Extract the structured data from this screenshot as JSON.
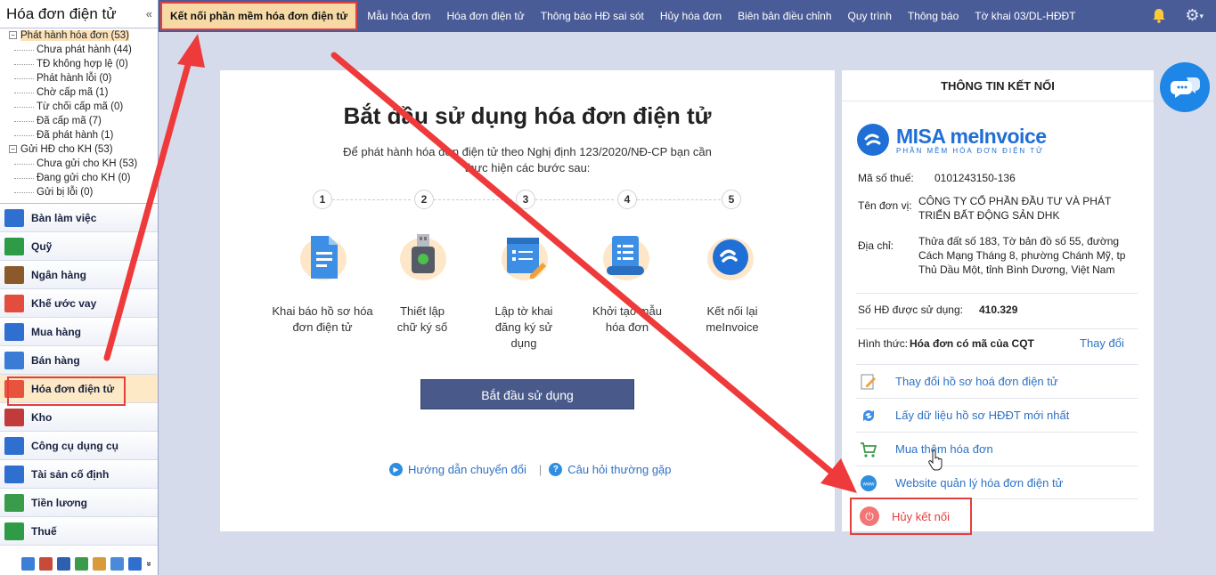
{
  "sidebar": {
    "title": "Hóa đơn điện tử",
    "collapse": "«",
    "tree": [
      {
        "label": "Phát hành hóa đơn (53)",
        "level": 0,
        "highlight": true
      },
      {
        "label": "Chưa phát hành (44)",
        "level": 1
      },
      {
        "label": "TĐ không hợp lệ (0)",
        "level": 1
      },
      {
        "label": "Phát hành lỗi (0)",
        "level": 1
      },
      {
        "label": "Chờ cấp mã (1)",
        "level": 1
      },
      {
        "label": "Từ chối cấp mã (0)",
        "level": 1
      },
      {
        "label": "Đã cấp mã (7)",
        "level": 1
      },
      {
        "label": "Đã phát hành (1)",
        "level": 1
      },
      {
        "label": "Gửi HĐ cho KH (53)",
        "level": 0
      },
      {
        "label": "Chưa gửi cho KH (53)",
        "level": 1
      },
      {
        "label": "Đang gửi cho KH (0)",
        "level": 1
      },
      {
        "label": "Gửi bị lỗi (0)",
        "level": 1
      }
    ],
    "modules": [
      {
        "label": "Bàn làm việc",
        "icon": "chart-icon",
        "color": "#2f6fd0"
      },
      {
        "label": "Quỹ",
        "icon": "money-icon",
        "color": "#2e9b46"
      },
      {
        "label": "Ngân hàng",
        "icon": "bank-icon",
        "color": "#8a5a2a"
      },
      {
        "label": "Khế ước vay",
        "icon": "contract-icon",
        "color": "#e24d3d"
      },
      {
        "label": "Mua hàng",
        "icon": "cart-icon",
        "color": "#2f6fd0"
      },
      {
        "label": "Bán hàng",
        "icon": "store-icon",
        "color": "#3a7bd5"
      },
      {
        "label": "Hóa đơn điện tử",
        "icon": "invoice-icon",
        "color": "#e8533c",
        "active": true
      },
      {
        "label": "Kho",
        "icon": "warehouse-icon",
        "color": "#c23b3b"
      },
      {
        "label": "Công cụ dụng cụ",
        "icon": "tools-icon",
        "color": "#2f6fd0"
      },
      {
        "label": "Tài sản cố định",
        "icon": "car-icon",
        "color": "#2f6fd0"
      },
      {
        "label": "Tiền lương",
        "icon": "salary-icon",
        "color": "#3a9b4a"
      },
      {
        "label": "Thuế",
        "icon": "tax-icon",
        "color": "#2e9b46"
      }
    ],
    "more": "»"
  },
  "topbar": {
    "tabs": [
      {
        "label": "Kết nối phần mềm hóa đơn điện tử",
        "active": true
      },
      {
        "label": "Mẫu hóa đơn"
      },
      {
        "label": "Hóa đơn điện tử"
      },
      {
        "label": "Thông báo HĐ sai sót"
      },
      {
        "label": "Hủy hóa đơn"
      },
      {
        "label": "Biên bản điều chỉnh"
      },
      {
        "label": "Quy trình"
      },
      {
        "label": "Thông báo"
      },
      {
        "label": "Tờ khai 03/DL-HĐĐT"
      }
    ],
    "bell_icon": "bell-icon",
    "gear_icon": "gear-icon"
  },
  "main": {
    "title": "Bắt đầu sử dụng hóa đơn điện tử",
    "subtitle": "Để phát hành hóa đơn điện tử theo Nghị định 123/2020/NĐ-CP bạn cần thực hiện các bước sau:",
    "steps": [
      {
        "num": "1",
        "label": "Khai báo hồ sơ hóa đơn điện tử"
      },
      {
        "num": "2",
        "label": "Thiết lập chữ ký số"
      },
      {
        "num": "3",
        "label": "Lập tờ khai đăng ký sử dụng"
      },
      {
        "num": "4",
        "label": "Khởi tạo mẫu hóa đơn"
      },
      {
        "num": "5",
        "label": "Kết nối lại meInvoice"
      }
    ],
    "start_button": "Bắt đầu sử dụng",
    "link_guide": "Hướng dẫn chuyển đổi",
    "link_faq": "Câu hỏi thường gặp"
  },
  "info": {
    "header": "THÔNG TIN KẾT NỐI",
    "brand_name": "MISA meInvoice",
    "brand_tag": "PHẦN MỀM HÓA ĐƠN ĐIỆN TỬ",
    "tax_label": "Mã số thuế:",
    "tax_value": "0101243150-136",
    "unit_label": "Tên đơn vị:",
    "unit_value": "CÔNG TY CỔ PHẦN ĐẦU TƯ VÀ PHÁT TRIỂN BẤT ĐỘNG SẢN DHK",
    "address_label": "Địa chỉ:",
    "address_value": "Thửa đất số 183, Tờ bản đồ số 55, đường Cách Mạng Tháng 8, phường Chánh Mỹ, tp Thủ Dầu Một, tỉnh Bình Dương, Việt Nam",
    "count_label": "Số HĐ được sử dụng:",
    "count_value": "410.329",
    "form_label": "Hình thức:",
    "form_value": "Hóa đơn có mã của CQT",
    "form_change": "Thay đổi",
    "actions": [
      {
        "label": "Thay đổi hồ sơ hoá đơn điện tử",
        "icon": "edit-icon"
      },
      {
        "label": "Lấy dữ liệu hồ sơ HĐĐT mới nhất",
        "icon": "refresh-icon"
      },
      {
        "label": "Mua thêm hóa đơn",
        "icon": "cart-icon"
      },
      {
        "label": "Website quản lý hóa đơn điện tử",
        "icon": "globe-icon"
      }
    ],
    "disconnect": "Hủy kết nối"
  },
  "colors": {
    "topbar": "#4a5c98",
    "accent": "#2f72c4",
    "highlight": "#e53e3e"
  }
}
